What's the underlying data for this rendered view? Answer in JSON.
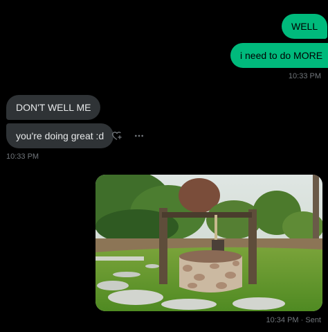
{
  "messages": {
    "sent_1": "WELL",
    "sent_2": "i need to do MORE",
    "sent_time": "10:33 PM",
    "recv_1": "DON'T WELL ME",
    "recv_2": "you're doing great :d",
    "recv_time": "10:33 PM",
    "photo_time": "10:34 PM · Sent"
  },
  "icons": {
    "react": "heart-plus-icon",
    "more": "more-dots-icon"
  },
  "colors": {
    "sent_bubble": "#00ba7c",
    "received_bubble": "#2f3336",
    "background": "#000000",
    "meta_text": "#71767b"
  },
  "photo": {
    "subject": "stone-well-photo"
  }
}
